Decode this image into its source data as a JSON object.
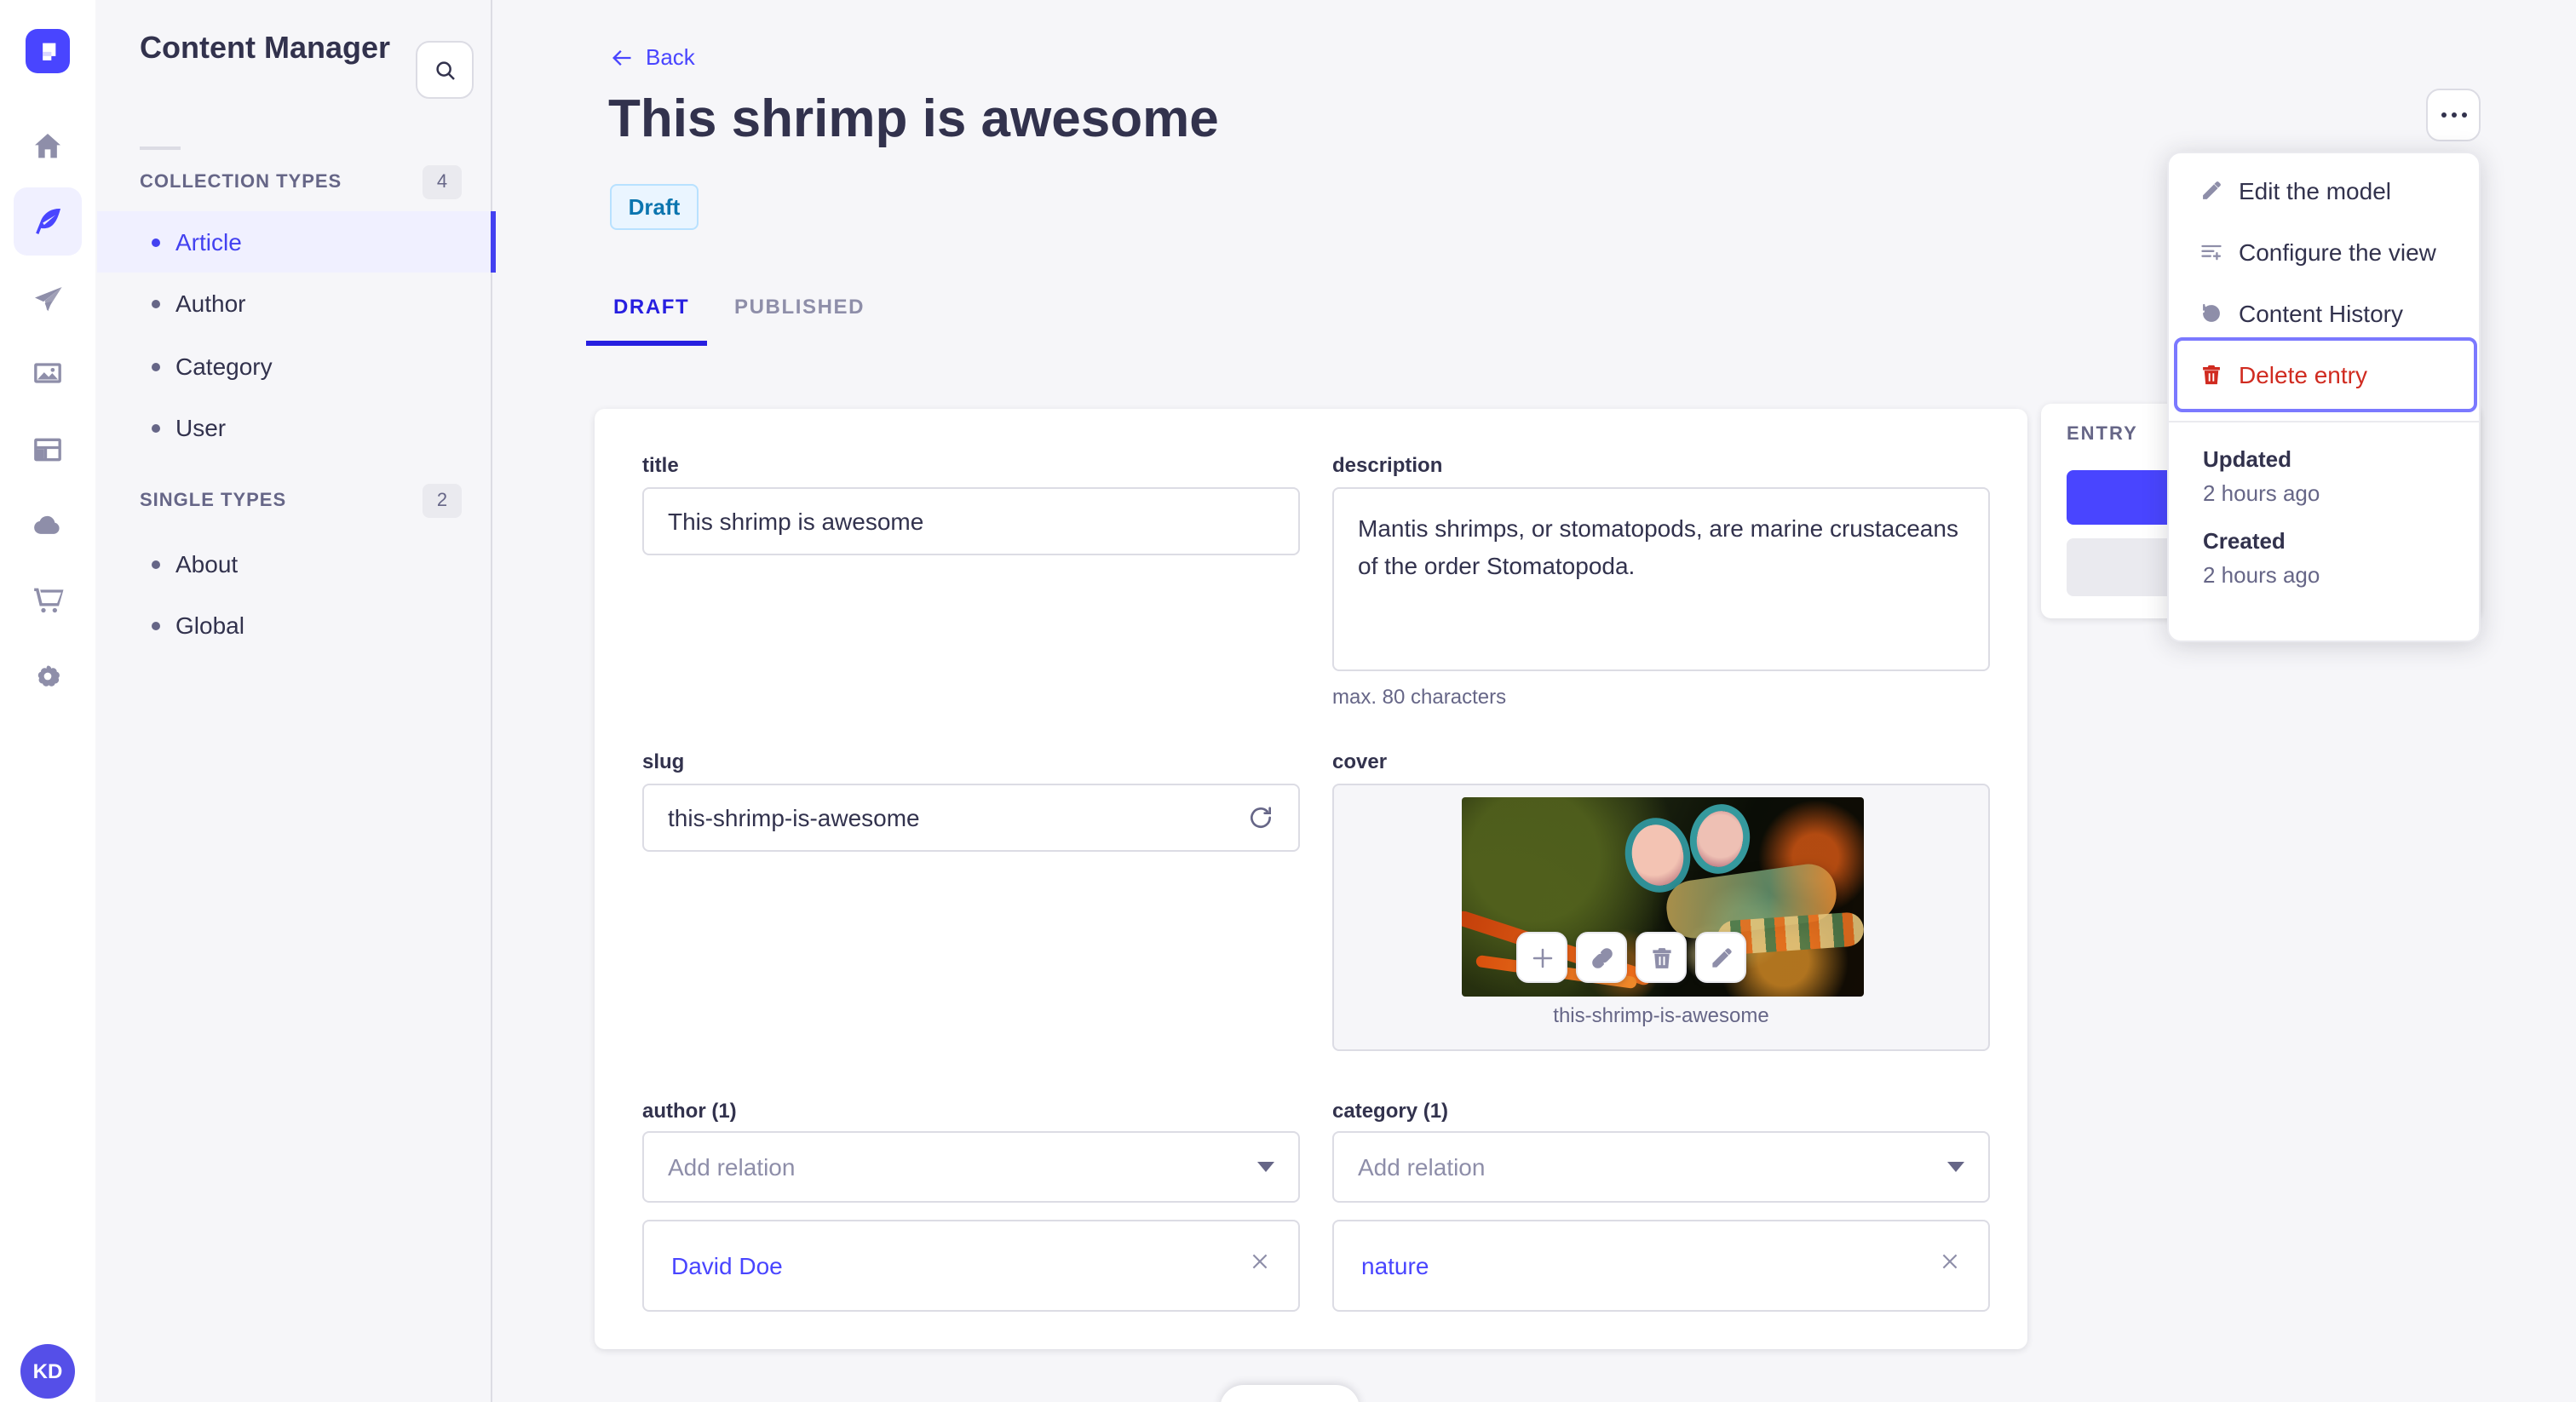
{
  "rail": {
    "brand": "strapi-logo",
    "items": [
      "home",
      "content-manager",
      "releases",
      "media-library",
      "content-type-builder",
      "cloud",
      "marketplace",
      "settings"
    ],
    "active_item": "content-manager",
    "avatar_initials": "KD"
  },
  "subnav": {
    "title": "Content Manager",
    "sections": [
      {
        "label": "COLLECTION TYPES",
        "count": "4",
        "items": [
          {
            "label": "Article",
            "active": true
          },
          {
            "label": "Author",
            "active": false
          },
          {
            "label": "Category",
            "active": false
          },
          {
            "label": "User",
            "active": false
          }
        ]
      },
      {
        "label": "SINGLE TYPES",
        "count": "2",
        "items": [
          {
            "label": "About",
            "active": false
          },
          {
            "label": "Global",
            "active": false
          }
        ]
      }
    ]
  },
  "header": {
    "back_label": "Back",
    "title": "This shrimp is awesome",
    "status_badge": "Draft"
  },
  "tabs": [
    {
      "label": "DRAFT",
      "active": true
    },
    {
      "label": "PUBLISHED",
      "active": false
    }
  ],
  "form": {
    "title": {
      "label": "title",
      "value": "This shrimp is awesome"
    },
    "description": {
      "label": "description",
      "value": "Mantis shrimps, or stomatopods, are marine crustaceans of the order Stomatopoda.",
      "hint": "max. 80 characters"
    },
    "slug": {
      "label": "slug",
      "value": "this-shrimp-is-awesome"
    },
    "cover": {
      "label": "cover",
      "caption": "this-shrimp-is-awesome",
      "actions": [
        "add",
        "copy-link",
        "delete",
        "edit"
      ]
    },
    "author": {
      "label": "author (1)",
      "placeholder": "Add relation",
      "relation": "David Doe"
    },
    "category": {
      "label": "category (1)",
      "placeholder": "Add relation",
      "relation": "nature"
    }
  },
  "entry_panel": {
    "title": "ENTRY"
  },
  "menu": {
    "items": [
      {
        "label": "Edit the model",
        "icon": "pencil"
      },
      {
        "label": "Configure the view",
        "icon": "configure-list"
      },
      {
        "label": "Content History",
        "icon": "history-clock"
      },
      {
        "label": "Delete entry",
        "icon": "trash",
        "danger": true,
        "focused": true
      }
    ],
    "meta": [
      {
        "label": "Updated",
        "value": "2 hours ago"
      },
      {
        "label": "Created",
        "value": "2 hours ago"
      }
    ]
  },
  "colors": {
    "primary": "#4945ff",
    "primary_dark": "#271fe0",
    "primary_light_bg": "#f0f0ff",
    "focus_ring": "#7b79ff",
    "danger": "#d02b20",
    "draft_bg": "#eaf5ff",
    "draft_border": "#b8e1ff",
    "draft_text": "#0c75af",
    "text": "#32324d",
    "text_muted": "#666687",
    "border": "#dcdce4",
    "page_bg": "#f6f6f9"
  }
}
